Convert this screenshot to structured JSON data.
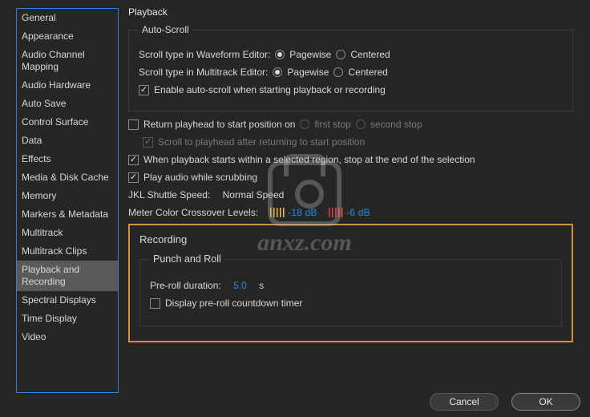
{
  "sidebar": {
    "items": [
      {
        "label": "General"
      },
      {
        "label": "Appearance"
      },
      {
        "label": "Audio Channel Mapping"
      },
      {
        "label": "Audio Hardware"
      },
      {
        "label": "Auto Save"
      },
      {
        "label": "Control Surface"
      },
      {
        "label": "Data"
      },
      {
        "label": "Effects"
      },
      {
        "label": "Media & Disk Cache"
      },
      {
        "label": "Memory"
      },
      {
        "label": "Markers & Metadata"
      },
      {
        "label": "Multitrack"
      },
      {
        "label": "Multitrack Clips"
      },
      {
        "label": "Playback and Recording"
      },
      {
        "label": "Spectral Displays"
      },
      {
        "label": "Time Display"
      },
      {
        "label": "Video"
      }
    ],
    "selected": "Playback and Recording"
  },
  "main": {
    "title": "Playback",
    "autoscroll": {
      "legend": "Auto-Scroll",
      "waveform_label": "Scroll type in Waveform Editor:",
      "multitrack_label": "Scroll type in Multitrack Editor:",
      "option_pagewise": "Pagewise",
      "option_centered": "Centered",
      "waveform_value": "Pagewise",
      "multitrack_value": "Pagewise",
      "enable_label": "Enable auto-scroll when starting playback or recording",
      "enable_checked": true
    },
    "return_playhead": {
      "label": "Return playhead to start position on",
      "checked": false,
      "option_first": "first stop",
      "option_second": "second stop",
      "scroll_to_playhead_label": "Scroll to playhead after returning to start position",
      "scroll_to_playhead_checked": true
    },
    "stop_at_end": {
      "label": "When playback starts within a selected region, stop at the end of the selection",
      "checked": true
    },
    "scrubbing": {
      "label": "Play audio while scrubbing",
      "checked": true
    },
    "shuttle": {
      "label": "JKL Shuttle Speed:",
      "value": "Normal Speed"
    },
    "meter": {
      "label": "Meter Color Crossover Levels:",
      "low_db": "-18",
      "high_db": "-6",
      "unit_low": "dB",
      "unit_high": "dB"
    },
    "recording": {
      "title": "Recording",
      "punch_legend": "Punch and Roll",
      "preroll_label": "Pre-roll duration:",
      "preroll_value": "5.0",
      "preroll_unit": "s",
      "countdown_label": "Display pre-roll countdown timer",
      "countdown_checked": false
    }
  },
  "footer": {
    "cancel": "Cancel",
    "ok": "OK"
  },
  "watermark": {
    "text": "anxz.com"
  }
}
